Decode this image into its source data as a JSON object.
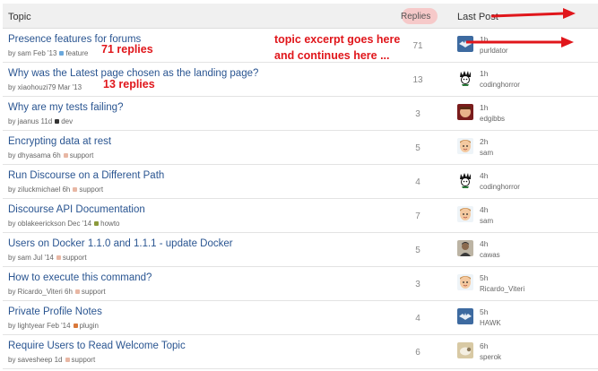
{
  "header": {
    "topic": "Topic",
    "replies": "Replies",
    "last_post": "Last Post"
  },
  "annotations": {
    "replies_71": "71 replies",
    "replies_13": "13 replies",
    "excerpt_line1": "topic excerpt goes here",
    "excerpt_line2": "and continues here ...",
    "color": "#e0161b"
  },
  "topics": [
    {
      "title": "Presence features for forums",
      "by": "by sam Feb '13",
      "tag": "feature",
      "tag_color": "#6aa8dc",
      "replies": "71",
      "age": "1h",
      "poster": "purldator",
      "avatar": "bat-blue"
    },
    {
      "title": "Why was the Latest page chosen as the landing page?",
      "by": "by xiaohouzi79 Mar '13",
      "tag": "",
      "tag_color": "",
      "replies": "13",
      "age": "1h",
      "poster": "codinghorror",
      "avatar": "spiky-hair"
    },
    {
      "title": "Why are my tests failing?",
      "by": "by jaanus 11d",
      "tag": "dev",
      "tag_color": "#333333",
      "replies": "3",
      "age": "1h",
      "poster": "edgibbs",
      "avatar": "red-face"
    },
    {
      "title": "Encrypting data at rest",
      "by": "by dhyasama 6h",
      "tag": "support",
      "tag_color": "#e8b7a4",
      "replies": "5",
      "age": "2h",
      "poster": "sam",
      "avatar": "cartoon-face"
    },
    {
      "title": "Run Discourse on a Different Path",
      "by": "by ziluckmichael 6h",
      "tag": "support",
      "tag_color": "#e8b7a4",
      "replies": "4",
      "age": "4h",
      "poster": "codinghorror",
      "avatar": "spiky-hair"
    },
    {
      "title": "Discourse API Documentation",
      "by": "by oblakeerickson Dec '14",
      "tag": "howto",
      "tag_color": "#8c9a3c",
      "replies": "7",
      "age": "4h",
      "poster": "sam",
      "avatar": "cartoon-face"
    },
    {
      "title": "Users on Docker 1.1.0 and 1.1.1 - update Docker",
      "by": "by sam Jul '14",
      "tag": "support",
      "tag_color": "#e8b7a4",
      "replies": "5",
      "age": "4h",
      "poster": "cawas",
      "avatar": "photo-man"
    },
    {
      "title": "How to execute this command?",
      "by": "by Ricardo_Viteri 6h",
      "tag": "support",
      "tag_color": "#e8b7a4",
      "replies": "3",
      "age": "5h",
      "poster": "Ricardo_Viteri",
      "avatar": "cartoon-face"
    },
    {
      "title": "Private Profile Notes",
      "by": "by lightyear Feb '14",
      "tag": "plugin",
      "tag_color": "#d9783a",
      "replies": "4",
      "age": "5h",
      "poster": "HAWK",
      "avatar": "bat-blue"
    },
    {
      "title": "Require Users to Read Welcome Topic",
      "by": "by savesheep 1d",
      "tag": "support",
      "tag_color": "#e8b7a4",
      "replies": "6",
      "age": "6h",
      "poster": "sperok",
      "avatar": "photo-sheep"
    }
  ]
}
